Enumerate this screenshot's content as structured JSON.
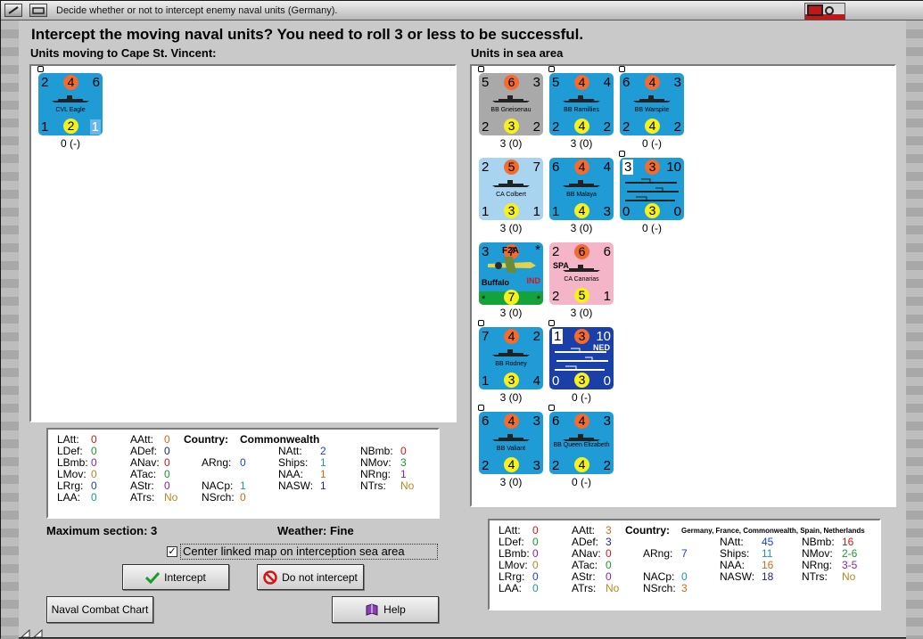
{
  "window": {
    "title": "Decide whether or not to intercept enemy naval units (Germany)."
  },
  "heading": "Intercept the moving naval units?  You need to roll 3 or less to be successful.",
  "left": {
    "label": "Units moving to Cape St. Vincent:",
    "units": [
      {
        "name": "CVL Eagle",
        "tl": "2",
        "tc": "4",
        "tr": "6",
        "bl": "1",
        "bc": "2",
        "br": "1",
        "count": "0 (-)"
      }
    ]
  },
  "right": {
    "label": "Units in sea area",
    "units": [
      {
        "name": "BB Gneisenau",
        "tl": "5",
        "tc": "6",
        "tr": "3",
        "bl": "2",
        "bc": "3",
        "br": "2",
        "count": "3 (0)"
      },
      {
        "name": "BB Ramillies",
        "tl": "5",
        "tc": "4",
        "tr": "4",
        "bl": "2",
        "bc": "4",
        "br": "2",
        "count": "3 (0)"
      },
      {
        "name": "BB Warspite",
        "tl": "6",
        "tc": "4",
        "tr": "3",
        "bl": "2",
        "bc": "4",
        "br": "2",
        "count": "0 (-)"
      },
      {
        "name": "CA Colbert",
        "tl": "2",
        "tc": "5",
        "tr": "7",
        "bl": "1",
        "bc": "3",
        "br": "1",
        "count": "3 (0)"
      },
      {
        "name": "BB Malaya",
        "tl": "6",
        "tc": "4",
        "tr": "4",
        "bl": "1",
        "bc": "4",
        "br": "3",
        "count": "3 (0)"
      },
      {
        "name": "",
        "tl": "3",
        "tc": "3",
        "tr": "10",
        "bl": "0",
        "bc": "3",
        "br": "0",
        "count": "0 (-)"
      },
      {
        "name": "Buffalo",
        "type": "F2A",
        "tag": "IND",
        "tl": "3",
        "tc": "7",
        "tr": "*",
        "bl": "*",
        "bc": "7",
        "br": "*",
        "count": "3 (0)"
      },
      {
        "name": "CA Canarias",
        "tag": "SPA",
        "tl": "2",
        "tc": "6",
        "tr": "6",
        "bl": "2",
        "bc": "5",
        "br": "1",
        "count": "3 (0)"
      },
      {
        "name": "BB Rodney",
        "tl": "7",
        "tc": "4",
        "tr": "2",
        "bl": "1",
        "bc": "3",
        "br": "4",
        "count": "3 (0)"
      },
      {
        "name": "",
        "tag": "NED",
        "tl": "1",
        "tc": "3",
        "tr": "10",
        "bl": "0",
        "bc": "3",
        "br": "0",
        "count": "0 (-)"
      },
      {
        "name": "BB Valiant",
        "tl": "6",
        "tc": "4",
        "tr": "3",
        "bl": "2",
        "bc": "4",
        "br": "3",
        "count": "3 (0)"
      },
      {
        "name": "BB Queen Elizabeth",
        "tl": "6",
        "tc": "4",
        "tr": "3",
        "bl": "2",
        "bc": "4",
        "br": "2",
        "count": "0 (-)"
      }
    ]
  },
  "stats_left": {
    "country_label": "Country:",
    "country": "Commonwealth",
    "LAtt": "0",
    "LDef": "0",
    "LBmb": "0",
    "LMov": "0",
    "LRrg": "0",
    "LAA": "0",
    "AAtt": "0",
    "ADef": "0",
    "ANav": "0",
    "ATac": "0",
    "AStr": "0",
    "ATrs": "No",
    "ARng": "0",
    "NACp": "1",
    "NSrch": "0",
    "NAtt": "2",
    "Ships": "1",
    "NAA": "1",
    "NASW": "1",
    "NBmb": "0",
    "NMov": "3",
    "NRng": "1",
    "NTrs": "No"
  },
  "stats_right": {
    "country_label": "Country:",
    "country": "Germany, France, Commonwealth, Spain, Netherlands",
    "LAtt": "0",
    "LDef": "0",
    "LBmb": "0",
    "LMov": "0",
    "LRrg": "0",
    "LAA": "0",
    "AAtt": "3",
    "ADef": "3",
    "ANav": "0",
    "ATac": "0",
    "AStr": "0",
    "ATrs": "No",
    "ARng": "7",
    "NACp": "0",
    "NSrch": "3",
    "NAtt": "45",
    "Ships": "11",
    "NAA": "16",
    "NASW": "18",
    "NBmb": "16",
    "NMov": "2-6",
    "NRng": "3-5",
    "NTrs": "No"
  },
  "status": {
    "max_section": "Maximum section: 3",
    "weather": "Weather:  Fine"
  },
  "center_map": {
    "label": "Center linked map on interception sea area",
    "checked": "✓"
  },
  "buttons": {
    "intercept": "Intercept",
    "no_intercept": "Do not intercept",
    "combat_chart": "Naval Combat Chart",
    "help": "Help"
  },
  "colors": {
    "commonwealth": "#1f9bd5",
    "germany": "#a9a9a9",
    "france": "#a9d4ef",
    "spain": "#f5b5c9",
    "netherlands": "#1a3fa8",
    "attack_circle": "#f26b2f",
    "move_circle": "#f6f11c"
  }
}
